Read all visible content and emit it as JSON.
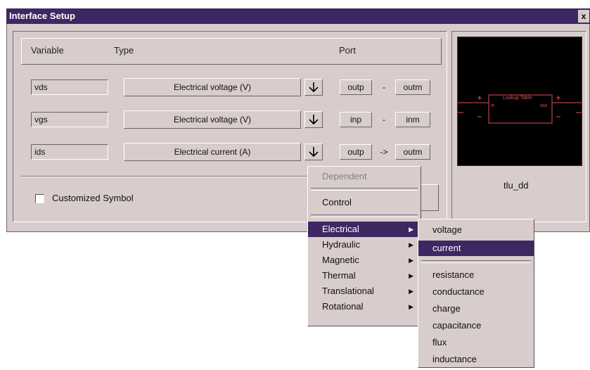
{
  "window": {
    "title": "Interface Setup",
    "close_label": "x"
  },
  "headers": {
    "variable": "Variable",
    "type": "Type",
    "port": "Port"
  },
  "rows": [
    {
      "variable": "vds",
      "type": "Electrical voltage (V)",
      "port_a": "outp",
      "sep": "-",
      "port_b": "outm"
    },
    {
      "variable": "vgs",
      "type": "Electrical voltage (V)",
      "port_a": "inp",
      "sep": "-",
      "port_b": "inm"
    },
    {
      "variable": "ids",
      "type": "Electrical current (A)",
      "port_a": "outp",
      "sep": "->",
      "port_b": "outm"
    }
  ],
  "customized_symbol": {
    "label": "Customized Symbol",
    "checked": false
  },
  "preview": {
    "block_label": "Lookup Table",
    "in_label": "in",
    "out_label": "out",
    "symbol_name": "tlu_dd"
  },
  "context_menu": {
    "dependent": "Dependent",
    "control": "Control",
    "categories": [
      "Electrical",
      "Hydraulic",
      "Magnetic",
      "Thermal",
      "Translational",
      "Rotational"
    ],
    "selected_category": "Electrical"
  },
  "submenu": {
    "primary": [
      "voltage",
      "current"
    ],
    "secondary": [
      "resistance",
      "conductance",
      "charge",
      "capacitance",
      "flux",
      "inductance"
    ],
    "selected": "current"
  },
  "colors": {
    "title_bar": "#3e2762",
    "selection": "#3e2762",
    "window_bg": "#d8cccc",
    "preview_bg": "#000000",
    "preview_lines": "#e05050"
  }
}
